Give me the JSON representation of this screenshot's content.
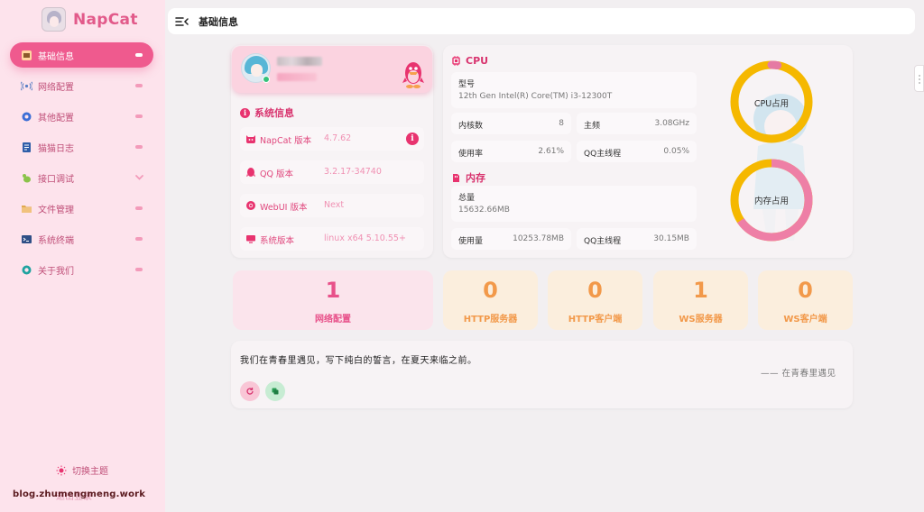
{
  "app": {
    "name": "NapCat"
  },
  "header": {
    "title": "基础信息"
  },
  "sidebar": {
    "items": [
      {
        "label": "基础信息",
        "active": true
      },
      {
        "label": "网络配置"
      },
      {
        "label": "其他配置"
      },
      {
        "label": "猫猫日志"
      },
      {
        "label": "接口调试",
        "has_chevron": true
      },
      {
        "label": "文件管理"
      },
      {
        "label": "系统终端"
      },
      {
        "label": "关于我们"
      }
    ],
    "theme_toggle": "切换主题",
    "bottom_faded": "退出登录"
  },
  "watermark": "blog.zhumengmeng.work",
  "system_info": {
    "title": "系统信息",
    "rows": [
      {
        "label": "NapCat 版本",
        "value": "4.7.62",
        "alert": "i"
      },
      {
        "label": "QQ 版本",
        "value": "3.2.17-34740"
      },
      {
        "label": "WebUI 版本",
        "value": "Next"
      },
      {
        "label": "系统版本",
        "value": "linux x64 5.10.55+"
      }
    ]
  },
  "cpu": {
    "title": "CPU",
    "model_label": "型号",
    "model_value": "12th Gen Intel(R) Core(TM) i3-12300T",
    "cores_label": "内核数",
    "cores_value": "8",
    "freq_label": "主频",
    "freq_value": "3.08GHz",
    "usage_label": "使用率",
    "usage_value": "2.61%",
    "qq_label": "QQ主线程",
    "qq_value": "0.05%",
    "gauge_label": "CPU占用",
    "gauge_fraction": 0.0261
  },
  "memory": {
    "title": "内存",
    "total_label": "总量",
    "total_value": "15632.66MB",
    "used_label": "使用量",
    "used_value": "10253.78MB",
    "qq_label": "QQ主线程",
    "qq_value": "30.15MB",
    "gauge_label": "内存占用",
    "gauge_fraction": 0.656
  },
  "counts": [
    {
      "value": "1",
      "label": "网络配置"
    },
    {
      "value": "0",
      "label": "HTTP服务器"
    },
    {
      "value": "0",
      "label": "HTTP客户端"
    },
    {
      "value": "1",
      "label": "WS服务器"
    },
    {
      "value": "0",
      "label": "WS客户端"
    }
  ],
  "quote": {
    "text": "我们在青春里遇见，写下纯白的誓言，在夏天来临之前。",
    "author": "—— 在青春里遇见"
  },
  "colors": {
    "accent": "#ef5a8e",
    "gauge_track": "#f5b800",
    "gauge_fill_cpu": "#e57aa3",
    "gauge_fill_mem": "#ee7fa6"
  }
}
